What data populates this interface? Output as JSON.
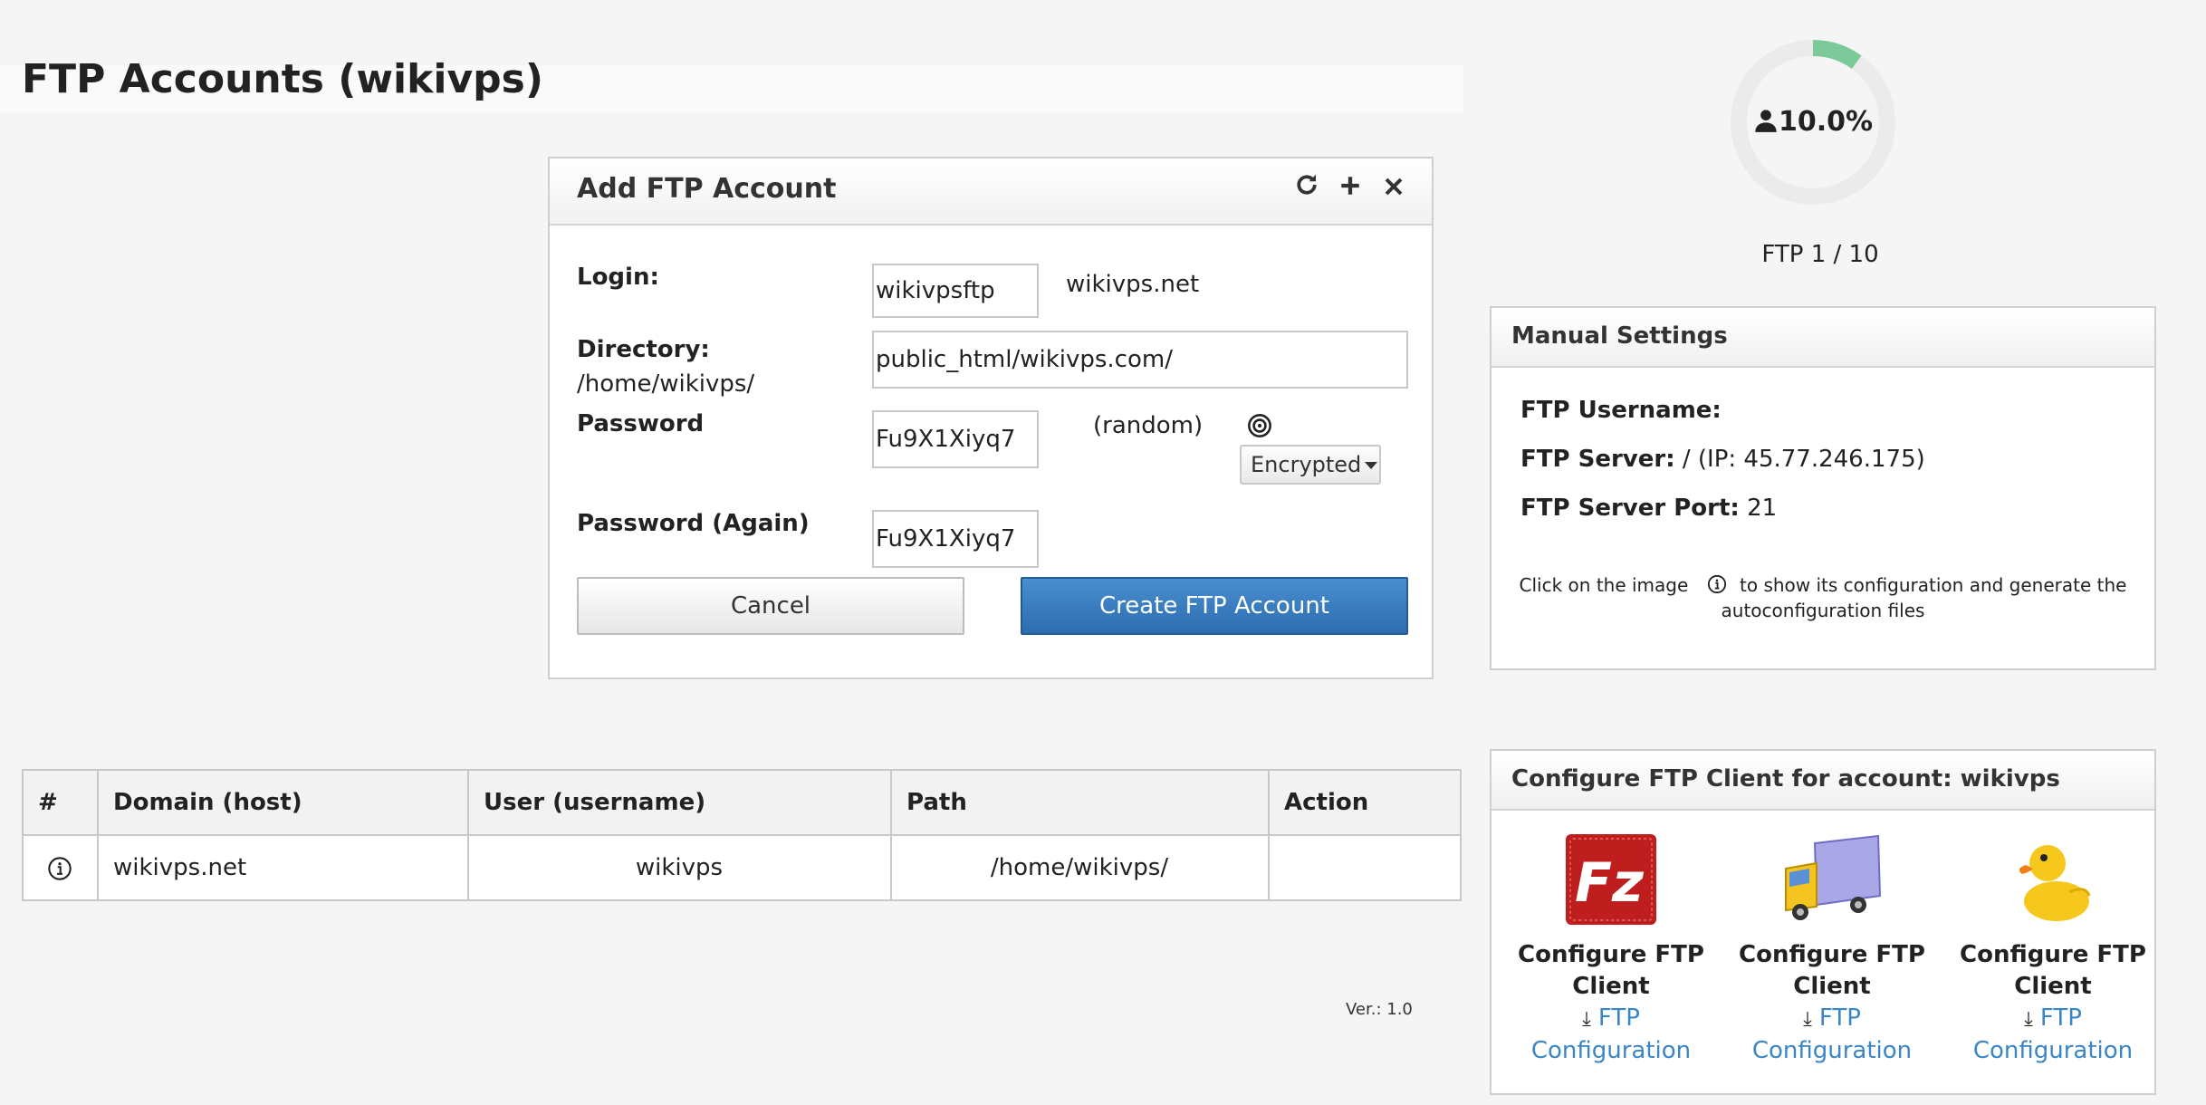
{
  "page": {
    "title": "FTP Accounts (wikivps)"
  },
  "dialog": {
    "title": "Add FTP Account",
    "icons": {
      "refresh": "refresh-icon",
      "add": "plus-icon",
      "close": "close-icon"
    },
    "login_label": "Login:",
    "login_value": "wikivpsftp",
    "login_domain": "wikivps.net",
    "directory_label": "Directory:",
    "directory_prefix": "/home/wikivps/",
    "directory_value": "public_html/wikivps.com/",
    "password_label": "Password",
    "password_value": "Fu9X1Xiyq7",
    "random_label": "(random)",
    "encryption_selected": "Encrypted",
    "password_again_label": "Password (Again)",
    "password_again_value": "Fu9X1Xiyq7",
    "cancel_label": "Cancel",
    "create_label": "Create FTP Account"
  },
  "table": {
    "headers": [
      "#",
      "Domain (host)",
      "User (username)",
      "Path",
      "Action"
    ],
    "rows": [
      {
        "domain": "wikivps.net",
        "user": "wikivps",
        "path": "/home/wikivps/",
        "action": ""
      }
    ]
  },
  "version": "Ver.: 1.0",
  "usage": {
    "percent_label": "10.0%",
    "fraction": 0.1,
    "count_label": "FTP 1 / 10",
    "accent": "#7cc99a"
  },
  "manual": {
    "title": "Manual Settings",
    "username_label": "FTP Username:",
    "username_value": "",
    "server_label": "FTP Server:",
    "server_value": " / (IP: 45.77.246.175)",
    "port_label": "FTP Server Port:",
    "port_value": " 21",
    "hint_before": "Click on the image",
    "hint_after": "to show its configuration and generate the",
    "hint_line2": "autoconfiguration files"
  },
  "configure": {
    "title": "Configure FTP Client for account: wikivps",
    "clients": [
      {
        "icon": "filezilla-icon",
        "name_line1": "Configure FTP",
        "name_line2": "Client",
        "link_line1": "FTP",
        "link_line2": "Configuration"
      },
      {
        "icon": "transmit-truck-icon",
        "name_line1": "Configure FTP",
        "name_line2": "Client",
        "link_line1": "FTP",
        "link_line2": "Configuration"
      },
      {
        "icon": "cyberduck-icon",
        "name_line1": "Configure FTP",
        "name_line2": "Client",
        "link_line1": "FTP",
        "link_line2": "Configuration"
      }
    ]
  },
  "colors": {
    "primary_button": "#2c6db0",
    "link": "#3a86c6"
  }
}
